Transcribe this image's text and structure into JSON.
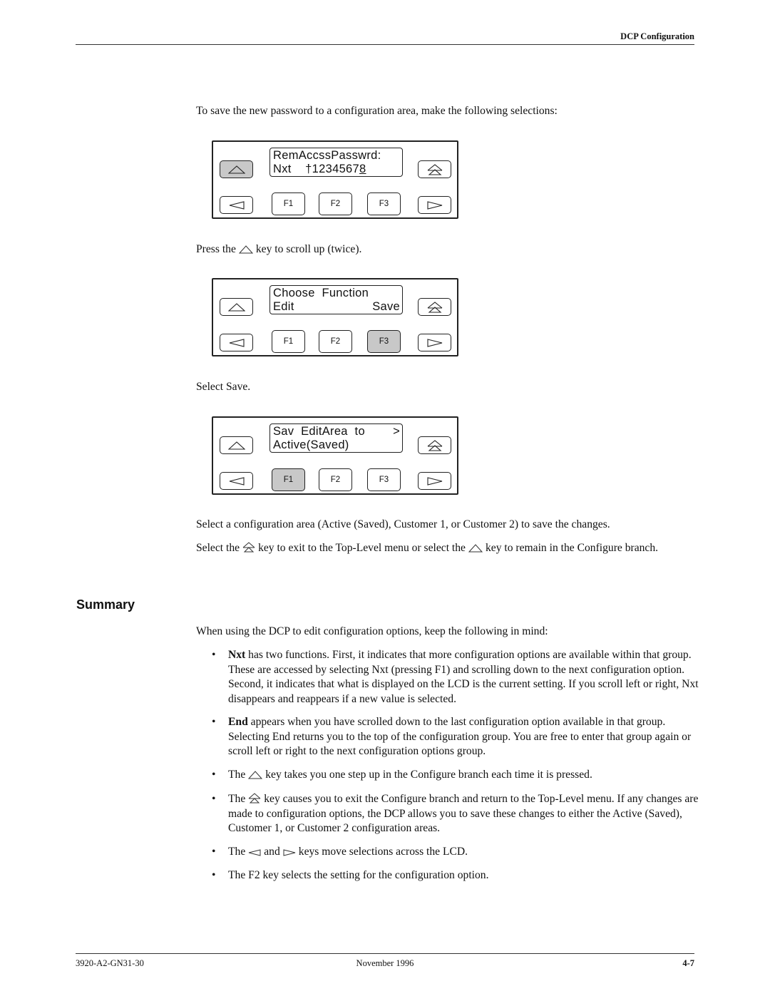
{
  "header": {
    "running_head": "DCP Configuration"
  },
  "intro": "To save the new password to a configuration area, make the following selections:",
  "panels": [
    {
      "lcd_line1": "RemAccssPasswrd:",
      "lcd_line2_left": "Nxt    †123456",
      "lcd_line2_underlined": "7",
      "lcd_line2_cursor": "8",
      "lcd_line2_right": "",
      "pressed_key": "up",
      "keys": {
        "f1": "F1",
        "f2": "F2",
        "f3": "F3"
      }
    },
    {
      "lcd_line1": "Choose  Function",
      "lcd_line2_left": "Edit",
      "lcd_line2_right": "Save",
      "pressed_key": "f3",
      "keys": {
        "f1": "F1",
        "f2": "F2",
        "f3": "F3"
      }
    },
    {
      "lcd_line1": "Sav  EditArea  to",
      "lcd_line1_right": ">",
      "lcd_line2_left": "Active(Saved)",
      "lcd_line2_right": "",
      "pressed_key": "f1",
      "keys": {
        "f1": "F1",
        "f2": "F2",
        "f3": "F3"
      }
    }
  ],
  "step1": {
    "before": "Press the",
    "icon": "up-arrow-key-icon",
    "after": "key to scroll up (twice)."
  },
  "step2": "Select Save.",
  "step3": "Select a configuration area (Active (Saved), Customer 1, or Customer 2) to save the changes.",
  "step4": {
    "part1": "Select the",
    "icon1": "top-level-key-icon",
    "part2": "key to exit to the Top-Level menu or select the",
    "icon2": "up-arrow-key-icon",
    "part3": "key to remain in the Configure branch."
  },
  "summary": {
    "title": "Summary",
    "intro": "When using the DCP to edit configuration options, keep the following in mind:",
    "bullets": [
      {
        "bold": "Nxt",
        "text": " has two functions. First, it indicates that more configuration options are available within that group. These are accessed by selecting Nxt (pressing F1) and scrolling down to the next configuration option. Second, it indicates that what is displayed on the LCD is the current setting. If you scroll left or right, Nxt disappears and reappears if a new value is selected."
      },
      {
        "bold": "End",
        "text": " appears when you have scrolled down to the last configuration option available in that group. Selecting End returns you to the top of the configuration group. You are free to enter that group again or scroll left or right to the next configuration options group."
      },
      {
        "before": "The",
        "after": "key takes you one step up in the Configure branch each time it is pressed."
      },
      {
        "before": "The",
        "after": "key causes you to exit the Configure branch and return to the Top-Level menu. If any changes are made to configuration options, the DCP allows you to save these changes to either the Active (Saved), Customer 1, or Customer 2 configuration areas."
      },
      {
        "before": "The",
        "middle": "and",
        "after": "keys move selections across the LCD."
      },
      {
        "text": "The F2 key selects the setting for the configuration option."
      }
    ],
    "bullet_char": "•"
  },
  "footer": {
    "doc_number": "3920-A2-GN31-30",
    "date": "November 1996",
    "page": "4-7"
  }
}
